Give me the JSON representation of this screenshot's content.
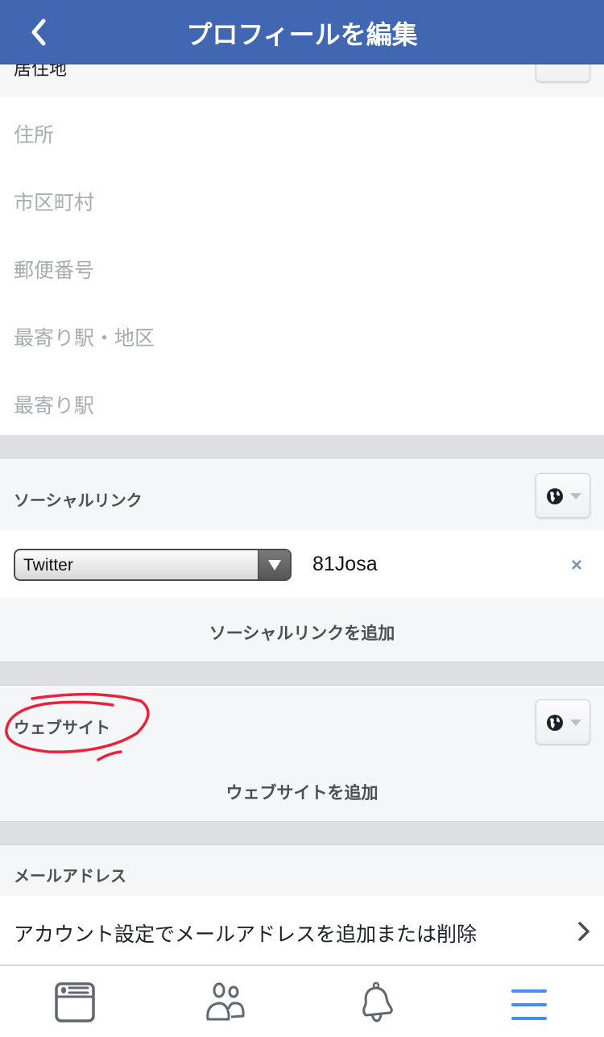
{
  "header": {
    "title": "プロフィールを編集",
    "back_icon": "chevron-left-icon"
  },
  "residence": {
    "title": "居住地",
    "fields": [
      {
        "placeholder": "住所"
      },
      {
        "placeholder": "市区町村"
      },
      {
        "placeholder": "郵便番号"
      },
      {
        "placeholder": "最寄り駅・地区"
      },
      {
        "placeholder": "最寄り駅"
      }
    ]
  },
  "social": {
    "title": "ソーシャルリンク",
    "privacy_icon": "globe-icon",
    "link": {
      "service": "Twitter",
      "username": "81Josa",
      "remove_label": "×"
    },
    "add_label": "ソーシャルリンクを追加"
  },
  "website": {
    "title": "ウェブサイト",
    "privacy_icon": "globe-icon",
    "add_label": "ウェブサイトを追加"
  },
  "email": {
    "title": "メールアドレス",
    "row_label": "アカウント設定でメールアドレスを追加または削除"
  },
  "tabbar": {
    "items": [
      "news-feed-icon",
      "friends-icon",
      "notifications-icon",
      "menu-icon"
    ],
    "active": "menu-icon",
    "active_color": "#4a8af4"
  },
  "colors": {
    "header": "#4267b2",
    "annotation": "#e8243c"
  }
}
